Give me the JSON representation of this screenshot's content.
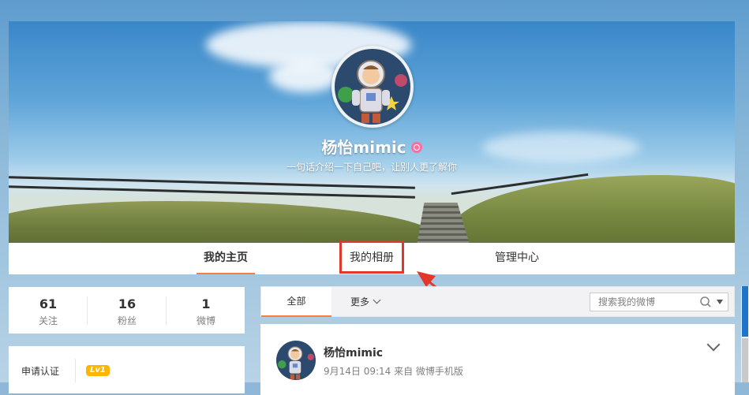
{
  "profile": {
    "name": "杨怡mimic",
    "intro": "一句话介绍一下自己吧，让别人更了解你"
  },
  "nav": {
    "tabs": [
      {
        "label": "我的主页",
        "active": true
      },
      {
        "label": "我的相册",
        "active": false
      },
      {
        "label": "管理中心",
        "active": false
      }
    ]
  },
  "stats": [
    {
      "value": "61",
      "label": "关注"
    },
    {
      "value": "16",
      "label": "粉丝"
    },
    {
      "value": "1",
      "label": "微博"
    }
  ],
  "verify": {
    "label": "申请认证",
    "level": "Lv1"
  },
  "feed": {
    "tab_all": "全部",
    "more": "更多",
    "search_placeholder": "搜索我的微博"
  },
  "post": {
    "author": "杨怡mimic",
    "meta": "9月14日 09:14 来自 微博手机版"
  },
  "colors": {
    "accent": "#fa7d3c",
    "highlight": "#e3372b",
    "level_badge": "#ffb600"
  }
}
